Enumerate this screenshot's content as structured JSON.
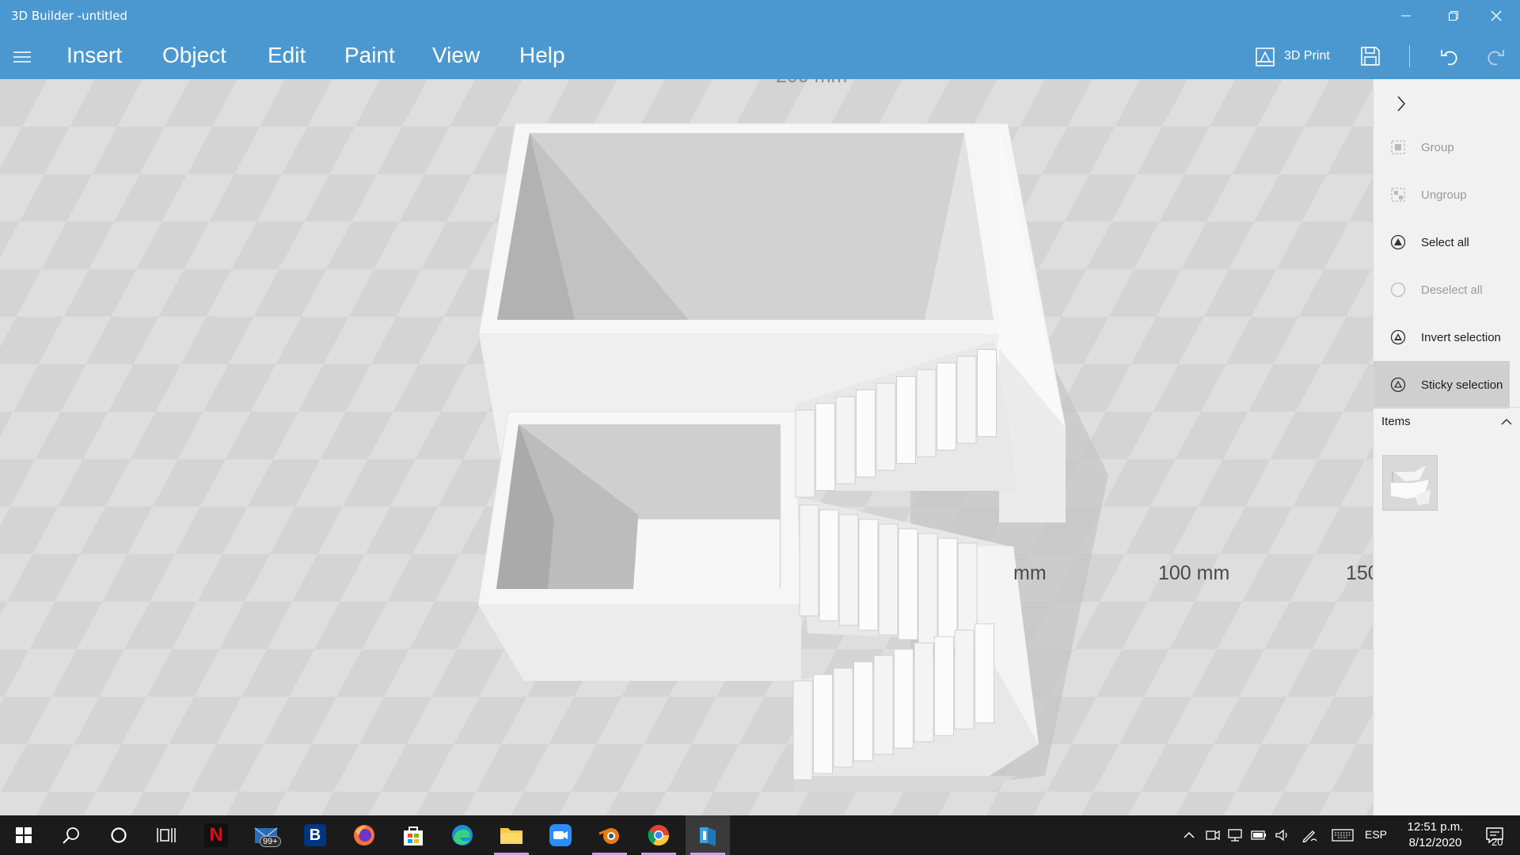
{
  "window": {
    "title": "3D Builder -untitled"
  },
  "menu": {
    "items": [
      "Insert",
      "Object",
      "Edit",
      "Paint",
      "View",
      "Help"
    ]
  },
  "toolbar": {
    "print_label": "3D Print",
    "icons": [
      "3d-print-icon",
      "save-icon",
      "undo-icon",
      "redo-icon"
    ]
  },
  "viewport": {
    "ruler_labels": {
      "top_partial": "200 mm",
      "mid_partial": "mm",
      "label_100": "100 mm",
      "label_150_partial": "150"
    }
  },
  "side_panel": {
    "actions": [
      {
        "label": "Group",
        "state": "disabled",
        "icon": "group-icon"
      },
      {
        "label": "Ungroup",
        "state": "disabled",
        "icon": "ungroup-icon"
      },
      {
        "label": "Select all",
        "state": "enabled",
        "icon": "select-all-icon"
      },
      {
        "label": "Deselect all",
        "state": "disabled",
        "icon": "deselect-all-icon"
      },
      {
        "label": "Invert selection",
        "state": "enabled",
        "icon": "invert-selection-icon"
      },
      {
        "label": "Sticky selection",
        "state": "active",
        "icon": "sticky-selection-icon"
      }
    ],
    "items_header": "Items"
  },
  "taskbar": {
    "apps": [
      "start",
      "search",
      "cortana",
      "task-view",
      "netflix",
      "mail",
      "booking",
      "firefox",
      "store",
      "edge",
      "file-explorer",
      "zoom",
      "blender",
      "chrome",
      "3d-builder"
    ],
    "mail_badge": "99+",
    "booking_letter": "B",
    "netflix_letter": "N",
    "language": "ESP",
    "time": "12:51 p.m.",
    "date": "8/12/2020",
    "notification_count": "20"
  },
  "colors": {
    "titlebar": "#4b98d1",
    "taskbar": "#1b1b1b",
    "panel": "#f1f1f1",
    "active_item": "#cfcfcf"
  }
}
